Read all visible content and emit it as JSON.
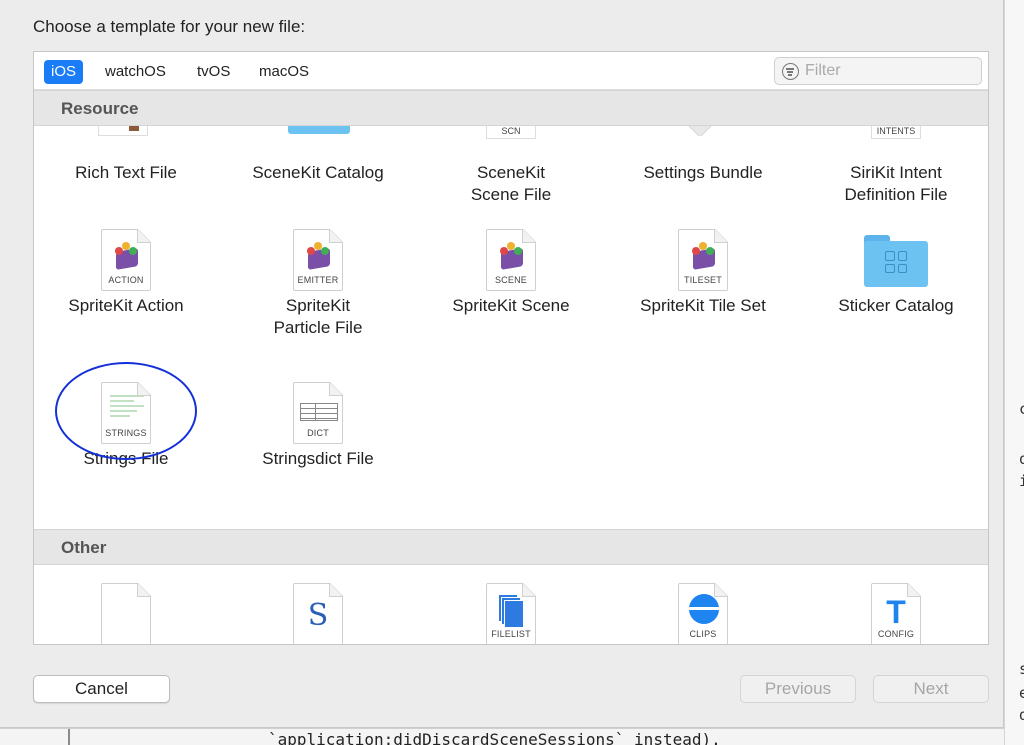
{
  "dialog": {
    "title": "Choose a template for your new file:",
    "tabs": [
      {
        "label": "iOS",
        "active": true
      },
      {
        "label": "watchOS",
        "active": false
      },
      {
        "label": "tvOS",
        "active": false
      },
      {
        "label": "macOS",
        "active": false
      }
    ],
    "filter_placeholder": "Filter",
    "sections": {
      "resource": "Resource",
      "other": "Other"
    },
    "resource_top_partial_tags": {
      "scn": "SCN",
      "intents": "INTENTS"
    },
    "resource_items": [
      {
        "label": "Rich Text File"
      },
      {
        "label": "SceneKit Catalog"
      },
      {
        "label": "SceneKit\nScene File"
      },
      {
        "label": "Settings Bundle"
      },
      {
        "label": "SiriKit Intent\nDefinition File"
      },
      {
        "label": "SpriteKit Action",
        "tag": "ACTION"
      },
      {
        "label": "SpriteKit\nParticle File",
        "tag": "EMITTER"
      },
      {
        "label": "SpriteKit Scene",
        "tag": "SCENE"
      },
      {
        "label": "SpriteKit Tile Set",
        "tag": "TILESET"
      },
      {
        "label": "Sticker Catalog"
      },
      {
        "label": "Strings File",
        "tag": "STRINGS"
      },
      {
        "label": "Stringsdict File",
        "tag": "DICT"
      }
    ],
    "other_items": [
      {
        "tag": ""
      },
      {
        "tag": "",
        "glyph": "S"
      },
      {
        "tag": "FILELIST"
      },
      {
        "tag": "CLIPS"
      },
      {
        "tag": "CONFIG",
        "glyph": "T"
      }
    ],
    "buttons": {
      "cancel": "Cancel",
      "previous": "Previous",
      "next": "Next"
    }
  },
  "background_editor": {
    "code_line": "`application:didDiscardSceneSessions` instead).",
    "side_chars": [
      "c",
      "o",
      "i",
      "s",
      "e",
      "d"
    ]
  },
  "colors": {
    "accent": "#1a7df7",
    "annotation_circle": "#1430d8"
  }
}
